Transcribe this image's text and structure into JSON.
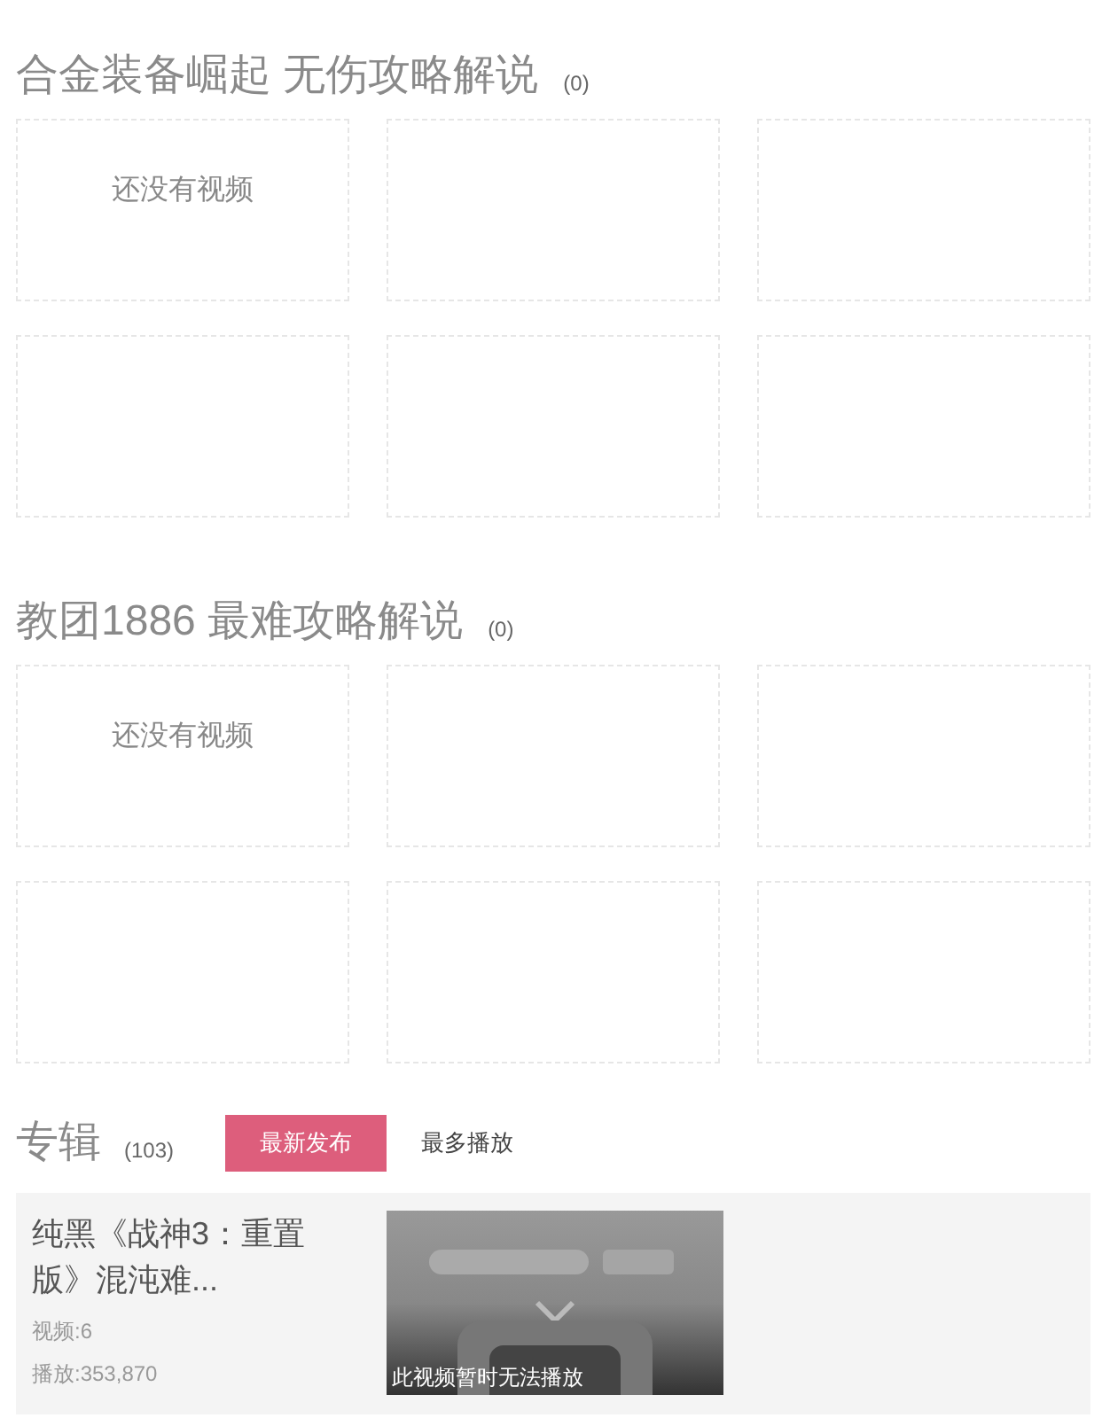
{
  "sections": [
    {
      "title": "合金装备崛起 无伤攻略解说",
      "count": "(0)",
      "cards": [
        {
          "kind": "message",
          "text": "还没有视频"
        },
        {
          "kind": "empty"
        },
        {
          "kind": "empty"
        },
        {
          "kind": "empty"
        },
        {
          "kind": "empty"
        },
        {
          "kind": "empty"
        }
      ]
    },
    {
      "title": "教团1886 最难攻略解说",
      "count": "(0)",
      "cards": [
        {
          "kind": "message",
          "text": "还没有视频"
        },
        {
          "kind": "empty"
        },
        {
          "kind": "empty"
        },
        {
          "kind": "empty"
        },
        {
          "kind": "empty"
        },
        {
          "kind": "empty"
        }
      ]
    }
  ],
  "albums": {
    "title": "专辑",
    "count": "(103)",
    "sort_tabs": [
      {
        "label": "最新发布",
        "selected": true
      },
      {
        "label": "最多播放",
        "selected": false
      }
    ],
    "items": [
      {
        "title": "纯黑《战神3：重置版》混沌难...",
        "videos": "视频:6",
        "plays": "播放:353,870",
        "thumbnail": {
          "kind": "picture",
          "caption": "此视频暂时无法播放"
        }
      }
    ]
  }
}
